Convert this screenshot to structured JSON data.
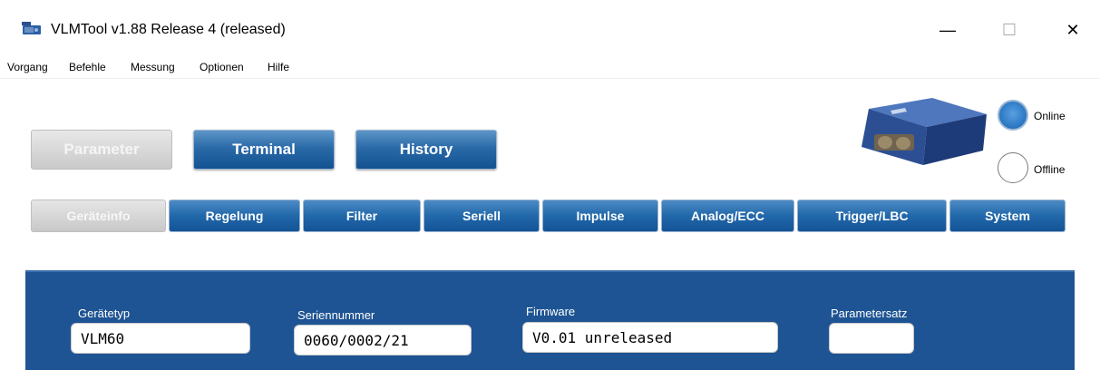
{
  "window": {
    "title": "VLMTool  v1.88 Release 4 (released)",
    "controls": {
      "minimize": "—",
      "maximize": "☐",
      "close": "✕"
    }
  },
  "menu": [
    "Vorgang",
    "Befehle",
    "Messung",
    "Optionen",
    "Hilfe"
  ],
  "main_buttons": [
    {
      "label": "Parameter",
      "state": "disabled"
    },
    {
      "label": "Terminal",
      "state": "enabled"
    },
    {
      "label": "History",
      "state": "enabled"
    }
  ],
  "tabs": [
    {
      "label": "Geräteinfo",
      "state": "selected-disabled"
    },
    {
      "label": "Regelung",
      "state": "enabled"
    },
    {
      "label": "Filter",
      "state": "enabled"
    },
    {
      "label": "Seriell",
      "state": "enabled"
    },
    {
      "label": "Impulse",
      "state": "enabled"
    },
    {
      "label": "Analog/ECC",
      "state": "enabled"
    },
    {
      "label": "Trigger/LBC",
      "state": "enabled"
    },
    {
      "label": "System",
      "state": "enabled"
    }
  ],
  "status": {
    "online_label": "Online",
    "offline_label": "Offline",
    "selected": "Online"
  },
  "device_info": {
    "geraetetyp": {
      "label": "Gerätetyp",
      "value": "VLM60"
    },
    "seriennummer": {
      "label": "Seriennummer",
      "value": "0060/0002/21"
    },
    "firmware": {
      "label": "Firmware",
      "value": "V0.01 unreleased"
    },
    "parametersatz": {
      "label": "Parametersatz",
      "value": ""
    }
  },
  "colors": {
    "accent_blue": "#2168aa",
    "panel_blue": "#1e5493",
    "disabled_gray": "#c9c9c9"
  }
}
